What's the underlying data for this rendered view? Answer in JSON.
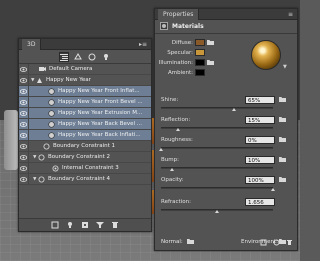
{
  "colors": {
    "panel_bg": "#535353",
    "selected_row": "#6d7e95",
    "diffuse_swatch": "#8a5a28",
    "specular_swatch": "#c9963a",
    "illumination_swatch": "#000000",
    "ambient_swatch": "#000000"
  },
  "panel_3d": {
    "tab": "3D",
    "menu_glyph": "▸≡",
    "toolbar_icons": [
      "scene-icon",
      "mesh-icon",
      "material-icon",
      "light-icon"
    ],
    "rows": [
      {
        "label": "Default Camera",
        "icon": "camera-icon",
        "selected": false
      },
      {
        "label": "Happy New Year",
        "icon": "mesh-icon",
        "selected": false
      },
      {
        "label": "Happy New Year Front Inflat...",
        "icon": "material-icon",
        "selected": true
      },
      {
        "label": "Happy New Year Front Bevel ...",
        "icon": "material-icon",
        "selected": true
      },
      {
        "label": "Happy New Year Extrusion M...",
        "icon": "material-icon",
        "selected": true
      },
      {
        "label": "Happy New Year Back Bevel ...",
        "icon": "material-icon",
        "selected": true
      },
      {
        "label": "Happy New Year Back Inflati...",
        "icon": "material-icon",
        "selected": true
      },
      {
        "label": "Boundary Constraint 1",
        "icon": "constraint-icon",
        "selected": false
      },
      {
        "label": "Boundary Constraint 2",
        "icon": "constraint-icon",
        "selected": false
      },
      {
        "label": "Internal Constraint 3",
        "icon": "constraint-icon",
        "selected": false
      },
      {
        "label": "Boundary Constraint 4",
        "icon": "constraint-icon",
        "selected": false
      }
    ],
    "footer_icons": [
      "render-icon",
      "light-add-icon",
      "new-layer-icon",
      "filter-icon",
      "delete-icon"
    ]
  },
  "properties": {
    "tab": "Properties",
    "menu_glyph": "≡",
    "section": "Materials",
    "swatches": [
      {
        "label": "Diffuse:"
      },
      {
        "label": "Specular:"
      },
      {
        "label": "Illumination:"
      },
      {
        "label": "Ambient:"
      }
    ],
    "props": [
      {
        "label": "Shine:",
        "value": "65%",
        "level": 0.65
      },
      {
        "label": "Reflection:",
        "value": "15%",
        "level": 0.15
      },
      {
        "label": "Roughness:",
        "value": "0%",
        "level": 0.0
      },
      {
        "label": "Bump:",
        "value": "10%",
        "level": 0.1
      },
      {
        "label": "Opacity:",
        "value": "100%",
        "level": 1.0
      },
      {
        "label": "Refraction:",
        "value": "1.656",
        "level": 0.5
      }
    ],
    "normal_label": "Normal:",
    "environment_label": "Environment:",
    "footer_icons": [
      "clip-icon",
      "reset-icon",
      "delete-icon"
    ]
  }
}
